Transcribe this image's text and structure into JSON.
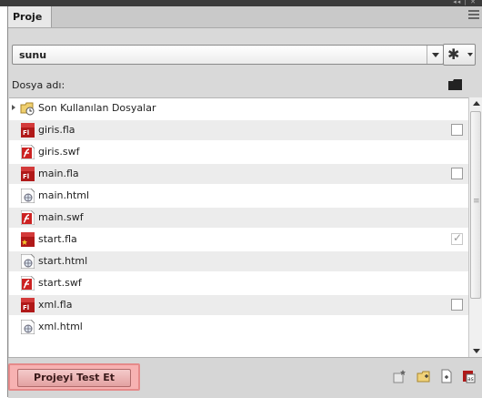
{
  "panel": {
    "tab_label": "Proje"
  },
  "project_select": {
    "value": "sunu"
  },
  "file_list": {
    "header": "Dosya adı:",
    "rows": [
      {
        "name": "Son Kullanılan Dosyalar",
        "icon": "recent-folder-icon",
        "checkbox": "none"
      },
      {
        "name": "giris.fla",
        "icon": "fla-file-icon",
        "checkbox": "unchecked"
      },
      {
        "name": "giris.swf",
        "icon": "swf-file-icon",
        "checkbox": "none"
      },
      {
        "name": "main.fla",
        "icon": "fla-file-icon",
        "checkbox": "unchecked"
      },
      {
        "name": "main.html",
        "icon": "html-file-icon",
        "checkbox": "none"
      },
      {
        "name": "main.swf",
        "icon": "swf-file-icon",
        "checkbox": "none"
      },
      {
        "name": "start.fla",
        "icon": "fla-default-file-icon",
        "checkbox": "checked"
      },
      {
        "name": "start.html",
        "icon": "html-file-icon",
        "checkbox": "none"
      },
      {
        "name": "start.swf",
        "icon": "swf-file-icon",
        "checkbox": "none"
      },
      {
        "name": "xml.fla",
        "icon": "fla-file-icon",
        "checkbox": "unchecked"
      },
      {
        "name": "xml.html",
        "icon": "html-file-icon",
        "checkbox": "none"
      }
    ]
  },
  "bottom_bar": {
    "test_button_label": "Projeyi Test Et",
    "icons": [
      "make-default-document-icon",
      "new-folder-icon",
      "new-file-icon",
      "edit-class-icon",
      "trash-icon"
    ]
  },
  "colors": {
    "panel_bg": "#d9d9d9",
    "row_alt": "#ececec",
    "test_button": "#f7b2b2",
    "fla_red": "#b01919",
    "swf_red": "#cc2222"
  }
}
